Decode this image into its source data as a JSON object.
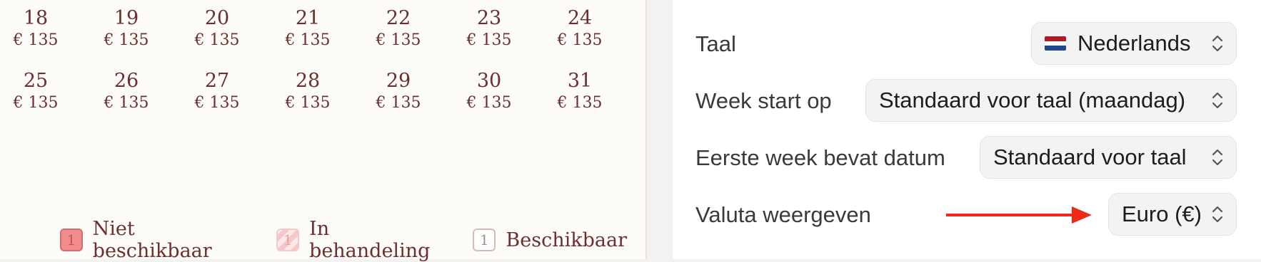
{
  "calendar": {
    "week1": [
      {
        "day": "18",
        "price": "€ 135"
      },
      {
        "day": "19",
        "price": "€ 135"
      },
      {
        "day": "20",
        "price": "€ 135"
      },
      {
        "day": "21",
        "price": "€ 135"
      },
      {
        "day": "22",
        "price": "€ 135"
      },
      {
        "day": "23",
        "price": "€ 135"
      },
      {
        "day": "24",
        "price": "€ 135"
      }
    ],
    "week2": [
      {
        "day": "25",
        "price": "€ 135"
      },
      {
        "day": "26",
        "price": "€ 135"
      },
      {
        "day": "27",
        "price": "€ 135"
      },
      {
        "day": "28",
        "price": "€ 135"
      },
      {
        "day": "29",
        "price": "€ 135"
      },
      {
        "day": "30",
        "price": "€ 135"
      },
      {
        "day": "31",
        "price": "€ 135"
      }
    ]
  },
  "legend": {
    "unavailable": {
      "count": "1",
      "label": "Niet beschikbaar"
    },
    "pending": {
      "count": "1",
      "label": "In behandeling"
    },
    "available": {
      "count": "1",
      "label": "Beschikbaar"
    }
  },
  "settings": {
    "language": {
      "label": "Taal",
      "value": "Nederlands",
      "flag_colors": [
        "#ae1c28",
        "#ffffff",
        "#21468b"
      ]
    },
    "week_start": {
      "label": "Week start op",
      "value": "Standaard voor taal (maandag)"
    },
    "first_week": {
      "label": "Eerste week bevat datum",
      "value": "Standaard voor taal"
    },
    "currency": {
      "label": "Valuta weergeven",
      "value": "Euro (€)"
    }
  },
  "colors": {
    "calendar_text": "#6b2f2f",
    "annotation_arrow": "#ee2a15"
  }
}
